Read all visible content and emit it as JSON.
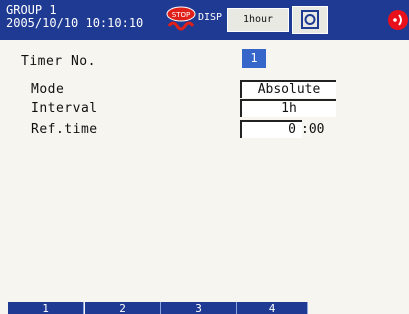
{
  "status_bar": {
    "group_name": "GROUP 1",
    "datetime": "2005/10/10 10:10:10",
    "disp_label": "DISP",
    "trend_interval": "1hour",
    "icons": [
      "stop-icon",
      "camera-icon",
      "alarm-icon"
    ]
  },
  "form": {
    "timer_no_label": "Timer No.",
    "timer_no_value": "1",
    "mode_label": "Mode",
    "mode_value": "Absolute",
    "interval_label": "Interval",
    "interval_value": "1h",
    "reftime_label": "Ref.time",
    "reftime_hour": "0",
    "reftime_minutes": ":00"
  },
  "softkeys": [
    "1",
    "2",
    "3",
    "4"
  ],
  "colors": {
    "status_bar": "#1f3a93",
    "selection": "#3666c9",
    "background": "#f7f5ef",
    "alarm": "#e8101a"
  }
}
